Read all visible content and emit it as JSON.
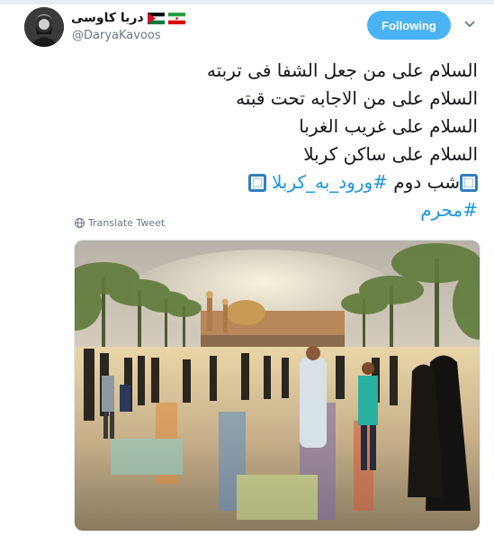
{
  "user": {
    "display_name": "دریا کاوسی",
    "handle": "@DaryaKavoos",
    "flags": [
      "jordan-flag",
      "iran-flag"
    ]
  },
  "follow_button": {
    "label": "Following"
  },
  "tweet": {
    "lines": [
      "السلام علی من جعل الشفا فی تربته",
      "السلام علی من الاجابه تحت قبته",
      "السلام علی غریب الغربا",
      "السلام علی ساکن کربلا"
    ],
    "line5_text": "شب دوم",
    "line5_hashtag": "#ورود_به_کربلا",
    "line6_hashtag": "#محرم",
    "emoji": "white-square-button-emoji"
  },
  "translate": {
    "label": "Translate Tweet",
    "icon": "globe-icon"
  },
  "media": {
    "type": "photo",
    "icon": "shrine-courtyard-photo"
  },
  "colors": {
    "accent": "#4ab3f4",
    "link": "#1b95e0",
    "secondary_text": "#657786"
  }
}
